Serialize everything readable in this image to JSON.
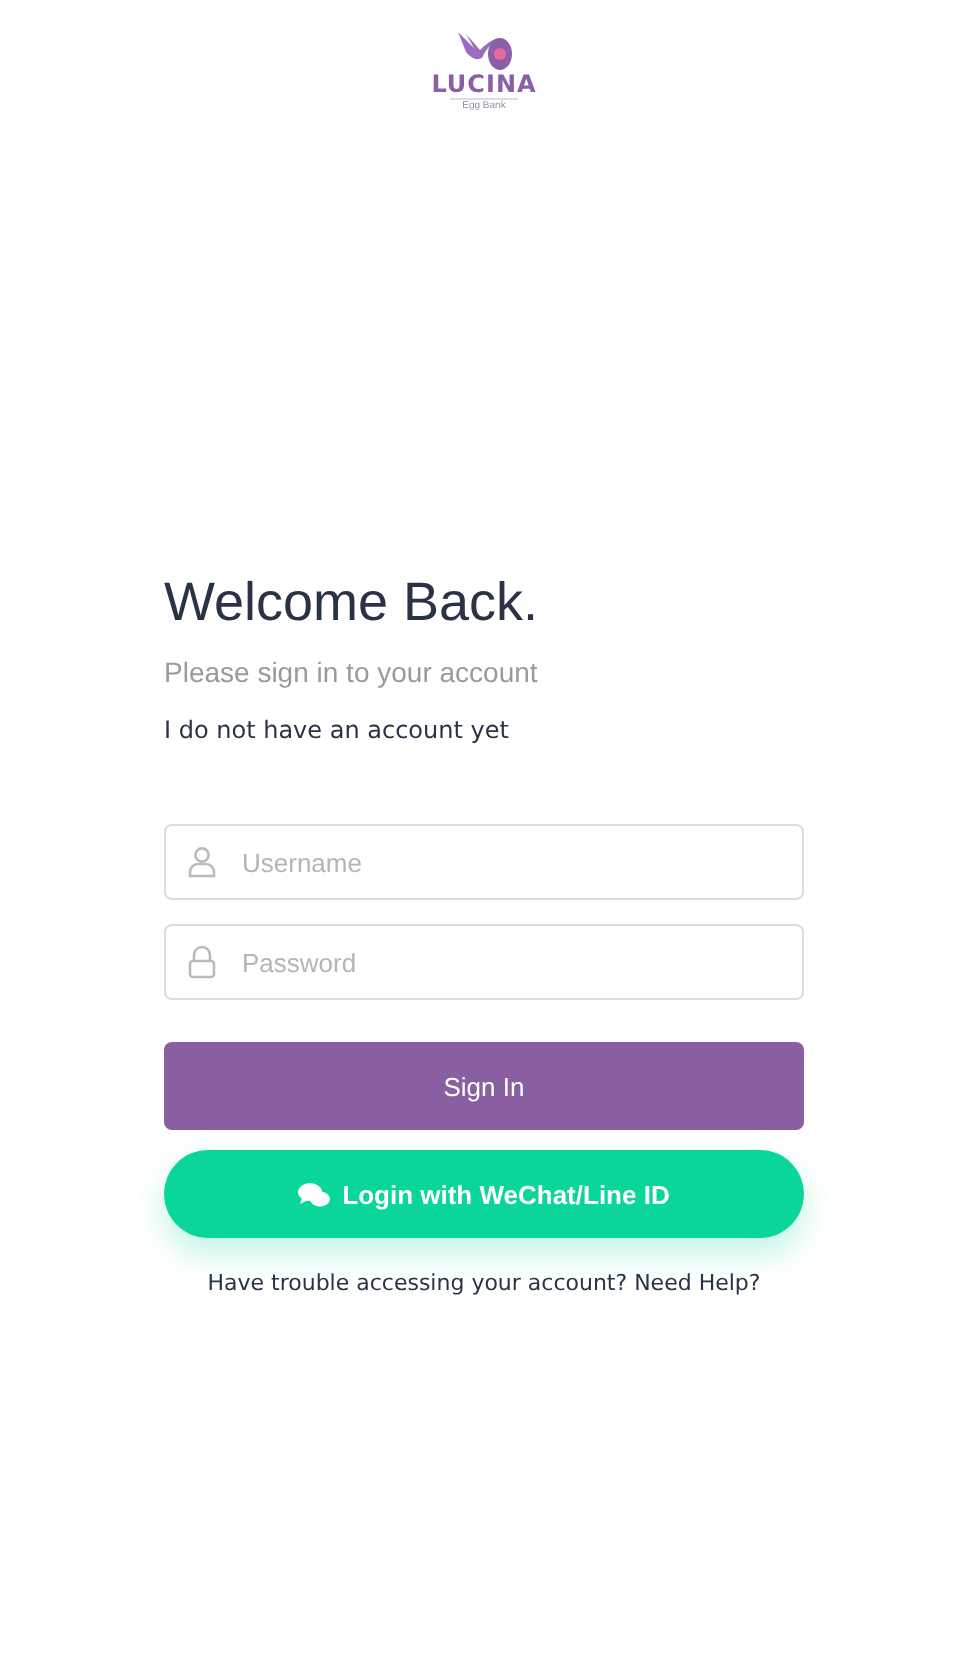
{
  "logo": {
    "name": "LUCINA",
    "tagline": "Egg Bank"
  },
  "heading": "Welcome Back.",
  "subtitle": "Please sign in to your account",
  "register_link": "I do not have an account yet",
  "fields": [
    {
      "kind": "user",
      "placeholder": "Username"
    },
    {
      "kind": "lock",
      "placeholder": "Password"
    }
  ],
  "sign_in_button": "Sign In",
  "wechat_button": "Login with WeChat/Line ID",
  "help_text": "Have trouble accessing your account? Need Help?"
}
